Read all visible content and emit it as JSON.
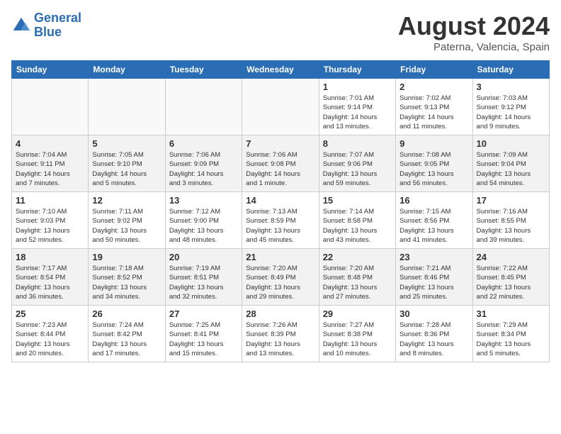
{
  "header": {
    "logo_line1": "General",
    "logo_line2": "Blue",
    "month": "August 2024",
    "location": "Paterna, Valencia, Spain"
  },
  "days_of_week": [
    "Sunday",
    "Monday",
    "Tuesday",
    "Wednesday",
    "Thursday",
    "Friday",
    "Saturday"
  ],
  "weeks": [
    [
      {
        "day": "",
        "info": ""
      },
      {
        "day": "",
        "info": ""
      },
      {
        "day": "",
        "info": ""
      },
      {
        "day": "",
        "info": ""
      },
      {
        "day": "1",
        "info": "Sunrise: 7:01 AM\nSunset: 9:14 PM\nDaylight: 14 hours\nand 13 minutes."
      },
      {
        "day": "2",
        "info": "Sunrise: 7:02 AM\nSunset: 9:13 PM\nDaylight: 14 hours\nand 11 minutes."
      },
      {
        "day": "3",
        "info": "Sunrise: 7:03 AM\nSunset: 9:12 PM\nDaylight: 14 hours\nand 9 minutes."
      }
    ],
    [
      {
        "day": "4",
        "info": "Sunrise: 7:04 AM\nSunset: 9:11 PM\nDaylight: 14 hours\nand 7 minutes."
      },
      {
        "day": "5",
        "info": "Sunrise: 7:05 AM\nSunset: 9:10 PM\nDaylight: 14 hours\nand 5 minutes."
      },
      {
        "day": "6",
        "info": "Sunrise: 7:06 AM\nSunset: 9:09 PM\nDaylight: 14 hours\nand 3 minutes."
      },
      {
        "day": "7",
        "info": "Sunrise: 7:06 AM\nSunset: 9:08 PM\nDaylight: 14 hours\nand 1 minute."
      },
      {
        "day": "8",
        "info": "Sunrise: 7:07 AM\nSunset: 9:06 PM\nDaylight: 13 hours\nand 59 minutes."
      },
      {
        "day": "9",
        "info": "Sunrise: 7:08 AM\nSunset: 9:05 PM\nDaylight: 13 hours\nand 56 minutes."
      },
      {
        "day": "10",
        "info": "Sunrise: 7:09 AM\nSunset: 9:04 PM\nDaylight: 13 hours\nand 54 minutes."
      }
    ],
    [
      {
        "day": "11",
        "info": "Sunrise: 7:10 AM\nSunset: 9:03 PM\nDaylight: 13 hours\nand 52 minutes."
      },
      {
        "day": "12",
        "info": "Sunrise: 7:11 AM\nSunset: 9:02 PM\nDaylight: 13 hours\nand 50 minutes."
      },
      {
        "day": "13",
        "info": "Sunrise: 7:12 AM\nSunset: 9:00 PM\nDaylight: 13 hours\nand 48 minutes."
      },
      {
        "day": "14",
        "info": "Sunrise: 7:13 AM\nSunset: 8:59 PM\nDaylight: 13 hours\nand 45 minutes."
      },
      {
        "day": "15",
        "info": "Sunrise: 7:14 AM\nSunset: 8:58 PM\nDaylight: 13 hours\nand 43 minutes."
      },
      {
        "day": "16",
        "info": "Sunrise: 7:15 AM\nSunset: 8:56 PM\nDaylight: 13 hours\nand 41 minutes."
      },
      {
        "day": "17",
        "info": "Sunrise: 7:16 AM\nSunset: 8:55 PM\nDaylight: 13 hours\nand 39 minutes."
      }
    ],
    [
      {
        "day": "18",
        "info": "Sunrise: 7:17 AM\nSunset: 8:54 PM\nDaylight: 13 hours\nand 36 minutes."
      },
      {
        "day": "19",
        "info": "Sunrise: 7:18 AM\nSunset: 8:52 PM\nDaylight: 13 hours\nand 34 minutes."
      },
      {
        "day": "20",
        "info": "Sunrise: 7:19 AM\nSunset: 8:51 PM\nDaylight: 13 hours\nand 32 minutes."
      },
      {
        "day": "21",
        "info": "Sunrise: 7:20 AM\nSunset: 8:49 PM\nDaylight: 13 hours\nand 29 minutes."
      },
      {
        "day": "22",
        "info": "Sunrise: 7:20 AM\nSunset: 8:48 PM\nDaylight: 13 hours\nand 27 minutes."
      },
      {
        "day": "23",
        "info": "Sunrise: 7:21 AM\nSunset: 8:46 PM\nDaylight: 13 hours\nand 25 minutes."
      },
      {
        "day": "24",
        "info": "Sunrise: 7:22 AM\nSunset: 8:45 PM\nDaylight: 13 hours\nand 22 minutes."
      }
    ],
    [
      {
        "day": "25",
        "info": "Sunrise: 7:23 AM\nSunset: 8:44 PM\nDaylight: 13 hours\nand 20 minutes."
      },
      {
        "day": "26",
        "info": "Sunrise: 7:24 AM\nSunset: 8:42 PM\nDaylight: 13 hours\nand 17 minutes."
      },
      {
        "day": "27",
        "info": "Sunrise: 7:25 AM\nSunset: 8:41 PM\nDaylight: 13 hours\nand 15 minutes."
      },
      {
        "day": "28",
        "info": "Sunrise: 7:26 AM\nSunset: 8:39 PM\nDaylight: 13 hours\nand 13 minutes."
      },
      {
        "day": "29",
        "info": "Sunrise: 7:27 AM\nSunset: 8:38 PM\nDaylight: 13 hours\nand 10 minutes."
      },
      {
        "day": "30",
        "info": "Sunrise: 7:28 AM\nSunset: 8:36 PM\nDaylight: 13 hours\nand 8 minutes."
      },
      {
        "day": "31",
        "info": "Sunrise: 7:29 AM\nSunset: 8:34 PM\nDaylight: 13 hours\nand 5 minutes."
      }
    ]
  ]
}
